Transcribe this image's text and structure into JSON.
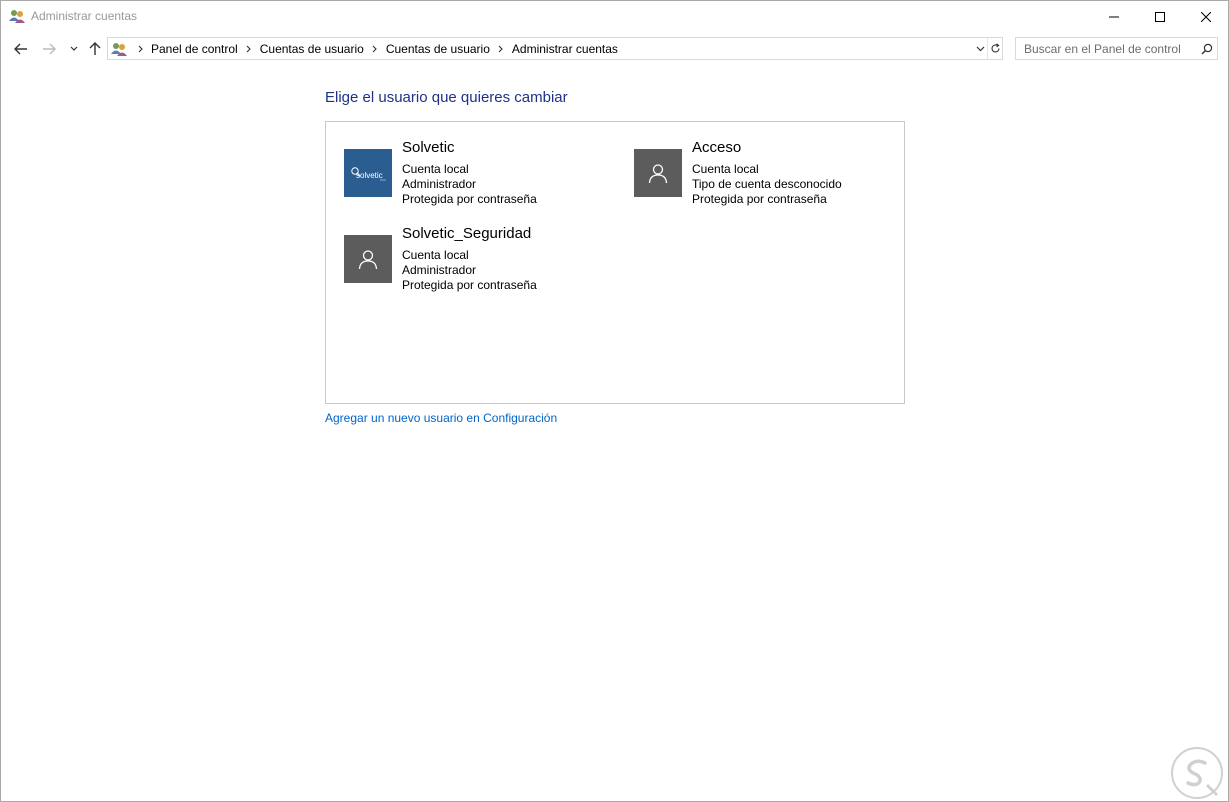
{
  "window": {
    "title": "Administrar cuentas",
    "icon": "users-icon"
  },
  "nav": {
    "back_icon": "arrow-left-icon",
    "forward_icon": "arrow-right-icon",
    "recent_icon": "chevron-down-icon",
    "up_icon": "arrow-up-icon"
  },
  "breadcrumb": {
    "items": [
      "Panel de control",
      "Cuentas de usuario",
      "Cuentas de usuario",
      "Administrar cuentas"
    ]
  },
  "search": {
    "placeholder": "Buscar en el Panel de control",
    "icon": "search-icon"
  },
  "main": {
    "heading": "Elige el usuario que quieres cambiar",
    "accounts": [
      {
        "name": "Solvetic",
        "line1": "Cuenta local",
        "line2": "Administrador",
        "line3": "Protegida por contraseña",
        "avatar": "solvetic-logo",
        "avatar_text": "solvetic"
      },
      {
        "name": "Acceso",
        "line1": "Cuenta local",
        "line2": "Tipo de cuenta desconocido",
        "line3": "Protegida por contraseña",
        "avatar": "user-icon"
      },
      {
        "name": "Solvetic_Seguridad",
        "line1": "Cuenta local",
        "line2": "Administrador",
        "line3": "Protegida por contraseña",
        "avatar": "user-icon"
      }
    ],
    "add_user_link": "Agregar un nuevo usuario en Configuración"
  },
  "colors": {
    "heading": "#1e3287",
    "link": "#0066cc",
    "avatar_default": "#5c5c5c",
    "avatar_solvetic": "#2b5d91"
  }
}
